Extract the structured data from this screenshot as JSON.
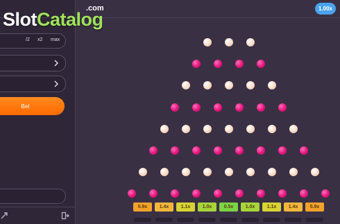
{
  "watermark": {
    "brand_main": "Slot",
    "brand_accent": "Catalog",
    "brand_suffix": ".com"
  },
  "multiplier_chip": "1.00x",
  "controls": {
    "bet_row": {
      "half_label": "/2",
      "double_label": "x2",
      "max_label": "max"
    },
    "bet_button_label": "Bet",
    "select_1": {
      "icon": "chevron-right-icon"
    },
    "select_2": {
      "icon": "chevron-right-icon"
    }
  },
  "footer": {
    "left_icon": "autoplay-icon",
    "right_icon": "exit-icon"
  },
  "board": {
    "rows": [
      [
        "cream",
        "cream",
        "cream"
      ],
      [
        "pink",
        "pink",
        "pink",
        "pink"
      ],
      [
        "cream",
        "cream",
        "cream",
        "cream",
        "cream"
      ],
      [
        "pink",
        "pink",
        "pink",
        "pink",
        "pink",
        "pink"
      ],
      [
        "cream",
        "cream",
        "cream",
        "cream",
        "cream",
        "cream",
        "cream"
      ],
      [
        "pink",
        "pink",
        "pink",
        "pink",
        "pink",
        "pink",
        "pink",
        "pink"
      ],
      [
        "cream",
        "cream",
        "cream",
        "cream",
        "cream",
        "cream",
        "cream",
        "cream",
        "cream"
      ],
      [
        "pink",
        "pink",
        "pink",
        "pink",
        "pink",
        "pink",
        "pink",
        "pink",
        "pink",
        "pink"
      ]
    ],
    "buckets": [
      {
        "label": "5.9x",
        "color": "#f2a12a"
      },
      {
        "label": "1.4x",
        "color": "#f2b63a"
      },
      {
        "label": "1.1x",
        "color": "#d7d434"
      },
      {
        "label": "1.0x",
        "color": "#a6d43a"
      },
      {
        "label": "0.5x",
        "color": "#7cd444"
      },
      {
        "label": "1.0x",
        "color": "#a6d43a"
      },
      {
        "label": "1.1x",
        "color": "#d7d434"
      },
      {
        "label": "1.4x",
        "color": "#f2b63a"
      },
      {
        "label": "5.9x",
        "color": "#f2a12a"
      }
    ]
  }
}
